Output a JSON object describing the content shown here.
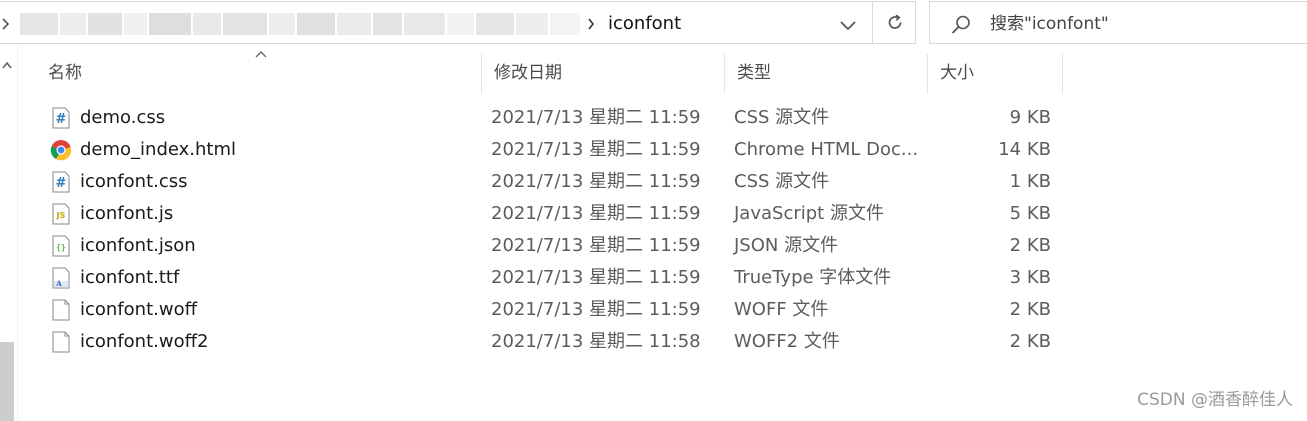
{
  "address_bar": {
    "current_folder": "iconfont",
    "search_placeholder": "搜索\"iconfont\""
  },
  "columns": {
    "name": "名称",
    "date_modified": "修改日期",
    "type": "类型",
    "size": "大小"
  },
  "files": [
    {
      "name": "demo.css",
      "date": "2021/7/13 星期二 11:59",
      "type": "CSS 源文件",
      "size": "9 KB",
      "icon": "css-file-icon"
    },
    {
      "name": "demo_index.html",
      "date": "2021/7/13 星期二 11:59",
      "type": "Chrome HTML Doc...",
      "size": "14 KB",
      "icon": "chrome-html-icon"
    },
    {
      "name": "iconfont.css",
      "date": "2021/7/13 星期二 11:59",
      "type": "CSS 源文件",
      "size": "1 KB",
      "icon": "css-file-icon"
    },
    {
      "name": "iconfont.js",
      "date": "2021/7/13 星期二 11:59",
      "type": "JavaScript 源文件",
      "size": "5 KB",
      "icon": "js-file-icon"
    },
    {
      "name": "iconfont.json",
      "date": "2021/7/13 星期二 11:59",
      "type": "JSON 源文件",
      "size": "2 KB",
      "icon": "json-file-icon"
    },
    {
      "name": "iconfont.ttf",
      "date": "2021/7/13 星期二 11:59",
      "type": "TrueType 字体文件",
      "size": "3 KB",
      "icon": "font-file-icon"
    },
    {
      "name": "iconfont.woff",
      "date": "2021/7/13 星期二 11:59",
      "type": "WOFF 文件",
      "size": "2 KB",
      "icon": "blank-file-icon"
    },
    {
      "name": "iconfont.woff2",
      "date": "2021/7/13 星期二 11:58",
      "type": "WOFF2 文件",
      "size": "2 KB",
      "icon": "blank-file-icon"
    }
  ],
  "watermark": "CSDN @酒香醉佳人"
}
